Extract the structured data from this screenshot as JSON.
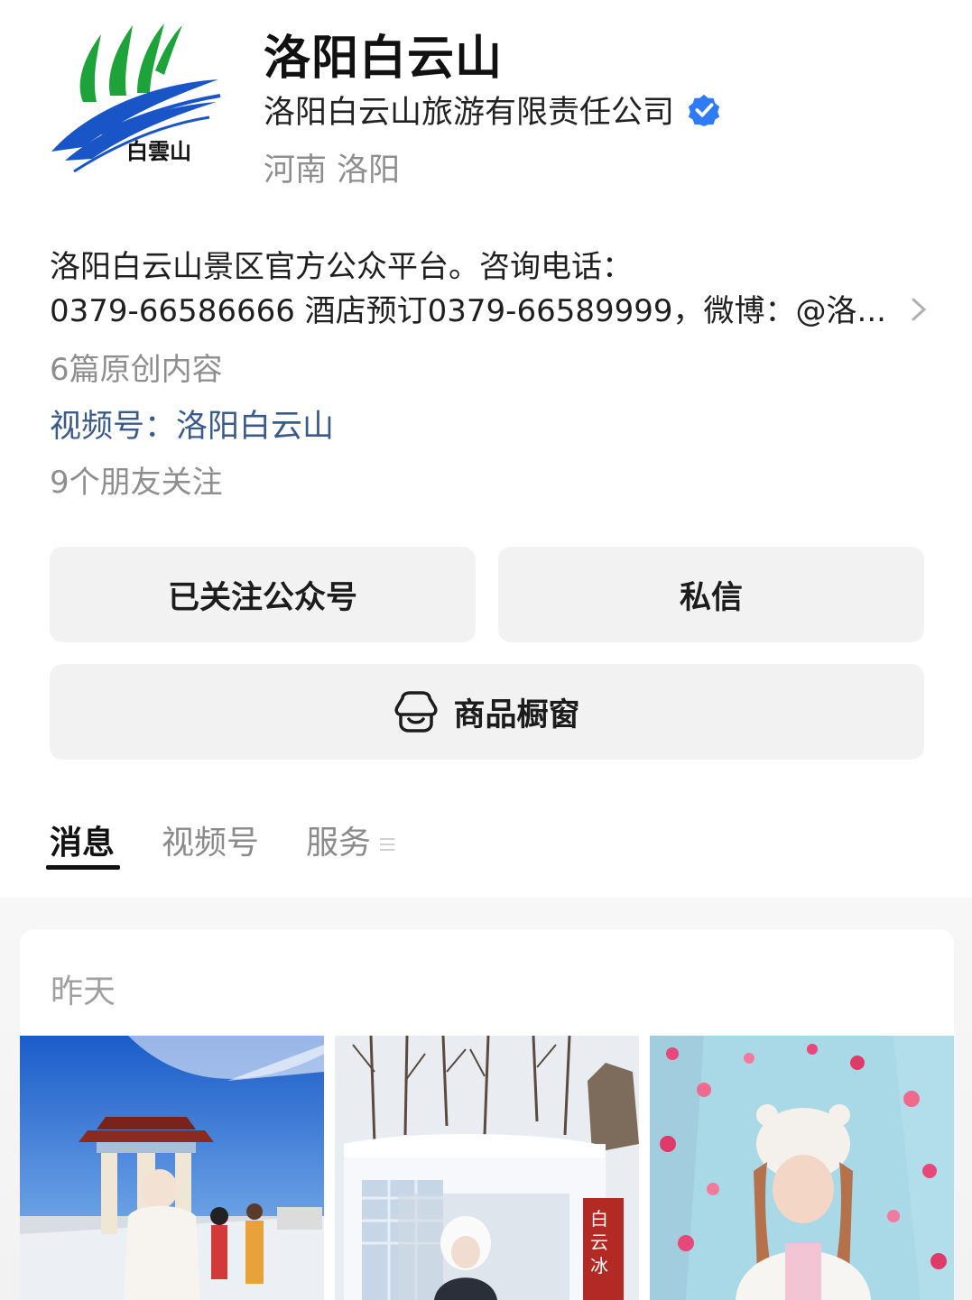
{
  "profile": {
    "name": "洛阳白云山",
    "company": "洛阳白云山旅游有限责任公司",
    "location": "河南 洛阳",
    "logo_text": "白雲山",
    "description_line1": "洛阳白云山景区官方公众平台。咨询电话：",
    "description_line2": "0379-66586666 酒店预订0379-66589999，微博：@洛...",
    "original_count": "6篇原创内容",
    "channels_label": "视频号：洛阳白云山",
    "friends_following": "9个朋友关注"
  },
  "actions": {
    "follow_label": "已关注公众号",
    "message_label": "私信",
    "shop_label": "商品橱窗"
  },
  "tabs": [
    {
      "label": "消息",
      "active": true
    },
    {
      "label": "视频号",
      "active": false
    },
    {
      "label": "服务",
      "active": false
    }
  ],
  "feed": {
    "date_label": "昨天",
    "thumbnails": [
      {
        "icon": "photo-gate-snow"
      },
      {
        "icon": "photo-ice-sign"
      },
      {
        "icon": "photo-ice-flowers"
      }
    ]
  },
  "colors": {
    "link": "#3a5a8c",
    "verified": "#2f7bf6",
    "logo_green": "#1ea33a",
    "logo_blue": "#1a55c8"
  }
}
